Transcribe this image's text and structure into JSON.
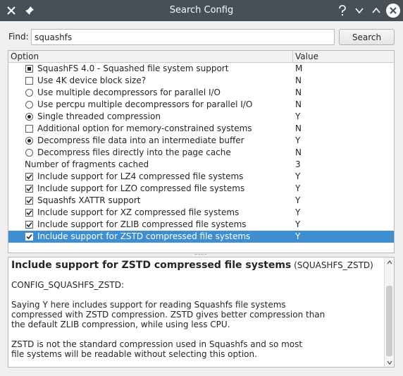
{
  "window": {
    "title": "Search Config"
  },
  "find": {
    "label": "Find:",
    "value": "squashfs",
    "button": "Search"
  },
  "tree": {
    "headers": {
      "option": "Option",
      "value": "Value"
    },
    "rows": [
      {
        "control": "tristate",
        "label": "SquashFS 4.0 - Squashed file system support",
        "value": "M",
        "selected": false
      },
      {
        "control": "checkbox",
        "checked": false,
        "label": "Use 4K device block size?",
        "value": "N",
        "selected": false
      },
      {
        "control": "radio",
        "checked": false,
        "label": "Use multiple decompressors for parallel I/O",
        "value": "N",
        "selected": false
      },
      {
        "control": "radio",
        "checked": false,
        "label": "Use percpu multiple decompressors for parallel I/O",
        "value": "N",
        "selected": false
      },
      {
        "control": "radio",
        "checked": true,
        "label": "Single threaded compression",
        "value": "Y",
        "selected": false
      },
      {
        "control": "checkbox",
        "checked": false,
        "label": "Additional option for memory-constrained systems",
        "value": "N",
        "selected": false
      },
      {
        "control": "radio",
        "checked": true,
        "label": "Decompress file data into an intermediate buffer",
        "value": "Y",
        "selected": false
      },
      {
        "control": "radio",
        "checked": false,
        "label": "Decompress files directly into the page cache",
        "value": "N",
        "selected": false
      },
      {
        "control": "none",
        "label": "Number of fragments cached",
        "value": "3",
        "selected": false
      },
      {
        "control": "checkbox",
        "checked": true,
        "label": "Include support for LZ4 compressed file systems",
        "value": "Y",
        "selected": false
      },
      {
        "control": "checkbox",
        "checked": true,
        "label": "Include support for LZO compressed file systems",
        "value": "Y",
        "selected": false
      },
      {
        "control": "checkbox",
        "checked": true,
        "label": "Squashfs XATTR support",
        "value": "Y",
        "selected": false
      },
      {
        "control": "checkbox",
        "checked": true,
        "label": "Include support for XZ compressed file systems",
        "value": "Y",
        "selected": false
      },
      {
        "control": "checkbox",
        "checked": true,
        "label": "Include support for ZLIB compressed file systems",
        "value": "Y",
        "selected": false
      },
      {
        "control": "checkbox",
        "checked": true,
        "label": "Include support for ZSTD compressed file systems",
        "value": "Y",
        "selected": true
      }
    ]
  },
  "help": {
    "title": "Include support for ZSTD compressed file systems",
    "symbol": " (SQUASHFS_ZSTD)",
    "config": "CONFIG_SQUASHFS_ZSTD:",
    "para1": "Saying Y here includes support for reading Squashfs file systems\ncompressed with ZSTD compression.  ZSTD gives better compression than\nthe default ZLIB compression, while using less CPU.",
    "para2": "ZSTD is not the standard compression used in Squashfs and so most\nfile systems will be readable without selecting this option."
  },
  "colors": {
    "titlebar": "#475057",
    "selection": "#3e8ed0"
  }
}
